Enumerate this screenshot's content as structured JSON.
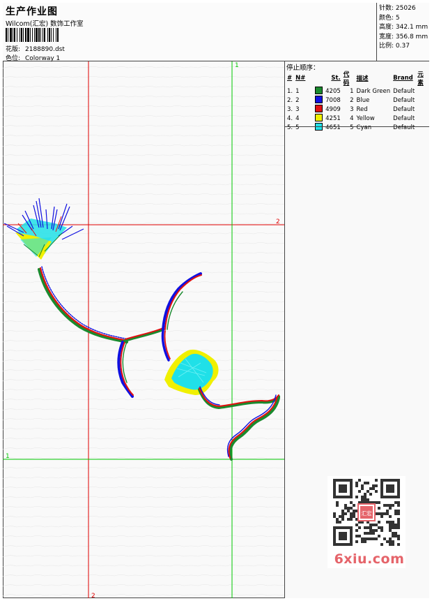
{
  "header": {
    "title": "生产作业图",
    "company": "Wilcom(汇宏) 数饰工作室",
    "design_label": "花版:",
    "design_value": "2188890.dst",
    "colorway_label": "色位:",
    "colorway_value": "Colorway 1"
  },
  "stats": [
    {
      "label": "针数",
      "value": "25026"
    },
    {
      "label": "颜色",
      "value": "5"
    },
    {
      "label": "高度",
      "value": "342.1 mm"
    },
    {
      "label": "宽度",
      "value": "356.8 mm"
    },
    {
      "label": "比例",
      "value": "0.37"
    }
  ],
  "stop_sequence": {
    "title": "停止顺序：",
    "columns": [
      "#",
      "N#",
      "St.",
      "代码",
      "描述",
      "Brand",
      "元素"
    ],
    "rows": [
      {
        "num": "1.",
        "n": "1",
        "color": "#1a8a2e",
        "st": "4205",
        "code": "1",
        "desc": "Dark Green",
        "brand": "Default"
      },
      {
        "num": "2.",
        "n": "2",
        "color": "#1010e0",
        "st": "7008",
        "code": "2",
        "desc": "Blue",
        "brand": "Default"
      },
      {
        "num": "3.",
        "n": "3",
        "color": "#e01010",
        "st": "4909",
        "code": "3",
        "desc": "Red",
        "brand": "Default"
      },
      {
        "num": "4.",
        "n": "4",
        "color": "#f0f000",
        "st": "4251",
        "code": "4",
        "desc": "Yellow",
        "brand": "Default"
      },
      {
        "num": "5.",
        "n": "5",
        "color": "#20e0e8",
        "st": "4651",
        "code": "5",
        "desc": "Cyan",
        "brand": "Default"
      }
    ]
  },
  "guides": {
    "red_vertical_label": "2",
    "red_horizontal_label": "2",
    "green_vertical_label": "1",
    "green_horizontal_label": "1"
  },
  "watermark": {
    "site": "6xiu.com",
    "seal_text": "汇宏"
  },
  "colors": {
    "guide_red": "#e00000",
    "guide_green": "#00c800",
    "thread_green": "#1a8a2e",
    "thread_blue": "#1010e0",
    "thread_red": "#e01010",
    "thread_yellow": "#f0f000",
    "thread_cyan": "#20e0e8",
    "watermark_pink": "#e5646a"
  }
}
